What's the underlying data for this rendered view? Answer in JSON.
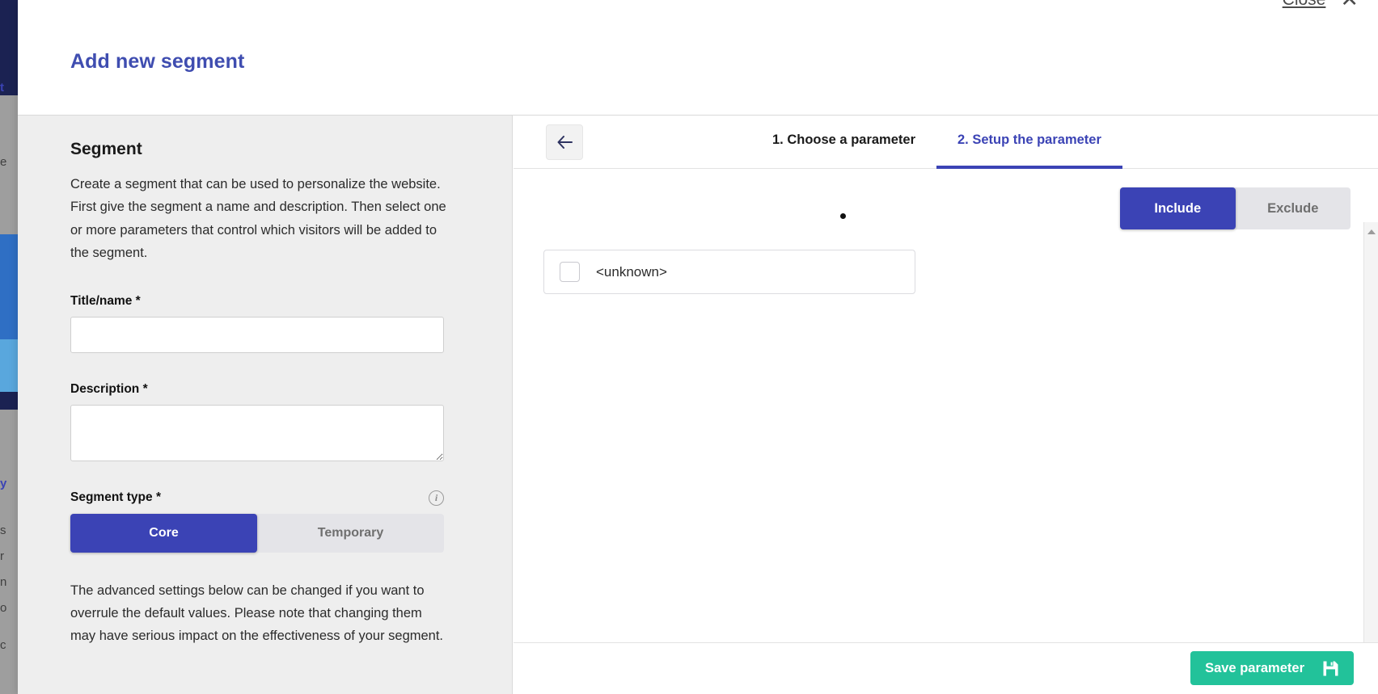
{
  "background_page": {
    "fragments": [
      "t",
      "e",
      "y",
      "s",
      "r",
      "n",
      "o",
      "c"
    ]
  },
  "modal": {
    "title": "Add new segment",
    "close_label": "Close",
    "close_icon": "close-icon"
  },
  "left_panel": {
    "section_title": "Segment",
    "description": "Create a segment that can be used to personalize the website. First give the segment a name and description. Then select one or more parameters that control which visitors will be added to the segment.",
    "title_field": {
      "label": "Title/name *",
      "value": "",
      "placeholder": ""
    },
    "description_field": {
      "label": "Description *",
      "value": "",
      "placeholder": ""
    },
    "segment_type": {
      "label": "Segment type *",
      "info_icon": "info-icon",
      "options": [
        "Core",
        "Temporary"
      ],
      "selected": "Core"
    },
    "advanced_note": "The advanced settings below can be changed if you want to overrule the default values. Please note that changing them may have serious impact on the effectiveness of your segment."
  },
  "right_panel": {
    "back_icon": "arrow-left-icon",
    "tabs": [
      {
        "label": "1. Choose a parameter",
        "active": false
      },
      {
        "label": "2. Setup the parameter",
        "active": true
      }
    ],
    "include_exclude": {
      "options": [
        "Include",
        "Exclude"
      ],
      "selected": "Include"
    },
    "values": [
      {
        "label": "<unknown>",
        "checked": false
      }
    ],
    "save_button": {
      "label": "Save parameter",
      "icon": "save-floppy-icon"
    }
  },
  "colors": {
    "brand_blue": "#3b43b5",
    "title_blue": "#3f4db0",
    "save_green": "#22c29a",
    "panel_grey": "#eeeeee",
    "toggle_track": "#e4e4e8"
  }
}
